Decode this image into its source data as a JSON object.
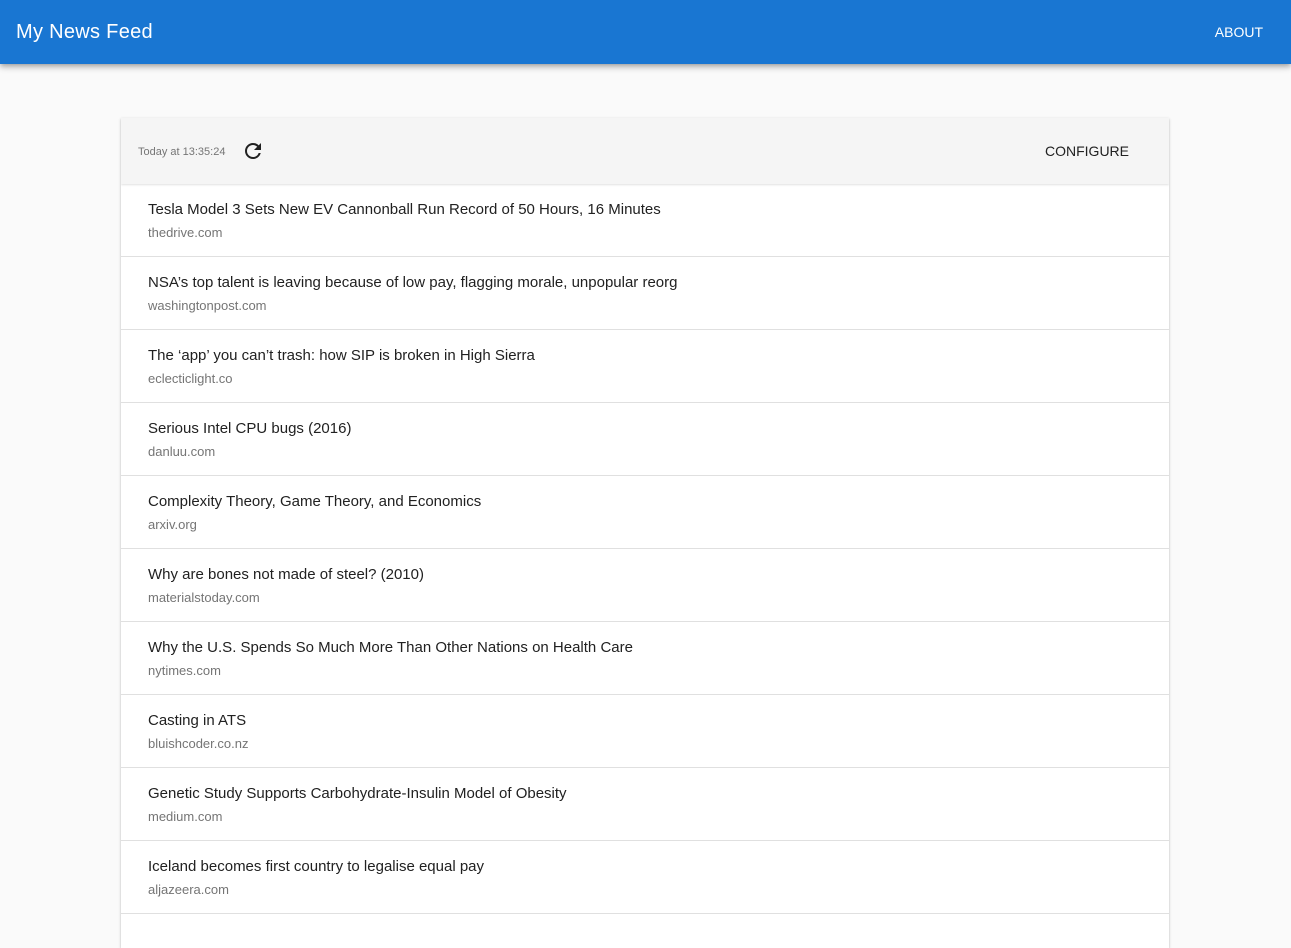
{
  "app_bar": {
    "title": "My News Feed",
    "about_label": "ABOUT",
    "color": "#1976d2"
  },
  "toolbar": {
    "last_updated": "Today at 13:35:24",
    "refresh_icon": "refresh-icon",
    "configure_label": "CONFIGURE"
  },
  "items": [
    {
      "title": "Tesla Model 3 Sets New EV Cannonball Run Record of 50 Hours, 16 Minutes",
      "source": "thedrive.com"
    },
    {
      "title": "NSA’s top talent is leaving because of low pay, flagging morale, unpopular reorg",
      "source": "washingtonpost.com"
    },
    {
      "title": "The ‘app’ you can’t trash: how SIP is broken in High Sierra",
      "source": "eclecticlight.co"
    },
    {
      "title": "Serious Intel CPU bugs (2016)",
      "source": "danluu.com"
    },
    {
      "title": "Complexity Theory, Game Theory, and Economics",
      "source": "arxiv.org"
    },
    {
      "title": "Why are bones not made of steel? (2010)",
      "source": "materialstoday.com"
    },
    {
      "title": "Why the U.S. Spends So Much More Than Other Nations on Health Care",
      "source": "nytimes.com"
    },
    {
      "title": "Casting in ATS",
      "source": "bluishcoder.co.nz"
    },
    {
      "title": "Genetic Study Supports Carbohydrate-Insulin Model of Obesity",
      "source": "medium.com"
    },
    {
      "title": "Iceland becomes first country to legalise equal pay",
      "source": "aljazeera.com"
    },
    {
      "title": "",
      "source": ""
    }
  ]
}
